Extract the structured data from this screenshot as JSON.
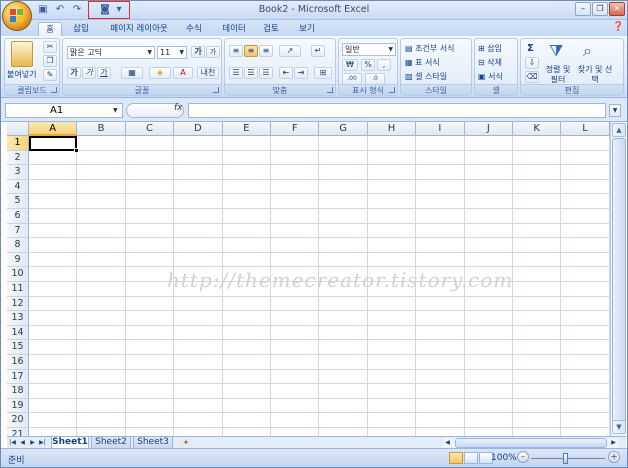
{
  "window": {
    "title": "Book2 - Microsoft Excel",
    "minimize": "–",
    "restore": "❐",
    "close": "✕"
  },
  "qat": {
    "save_icon": "save-icon",
    "undo_icon": "undo-icon",
    "redo_icon": "redo-icon",
    "camera_icon": "camera-icon",
    "customize_icon": "dropdown-icon"
  },
  "tabs": [
    "홈",
    "삽입",
    "페이지 레이아웃",
    "수식",
    "데이터",
    "검토",
    "보기"
  ],
  "active_tab": "홈",
  "ribbon": {
    "clipboard": {
      "label": "클립보드",
      "paste": "붙여넣기"
    },
    "font": {
      "label": "글꼴",
      "family": "맑은 고딕",
      "size": "11",
      "bold": "가",
      "italic": "가",
      "underline": "가",
      "grow": "가",
      "shrink": "가",
      "phonetic": "내천"
    },
    "alignment": {
      "label": "맞춤"
    },
    "number": {
      "label": "표시 형식",
      "format": "일반",
      "currency": "₩",
      "percent": "%",
      "comma": ",",
      "inc_decimal": ".00",
      "dec_decimal": ".0"
    },
    "styles": {
      "label": "스타일",
      "conditional": "조건부 서식",
      "table": "표 서식",
      "cell": "셀 스타일"
    },
    "cells": {
      "label": "셀",
      "insert": "삽입",
      "delete": "삭제",
      "format": "서식"
    },
    "editing": {
      "label": "편집",
      "sum": "Σ",
      "sort": "정렬 및 필터",
      "find": "찾기 및 선택"
    }
  },
  "formula_bar": {
    "name_box": "A1",
    "fx": "fx",
    "content": ""
  },
  "columns": [
    "A",
    "B",
    "C",
    "D",
    "E",
    "F",
    "G",
    "H",
    "I",
    "J",
    "K",
    "L"
  ],
  "rows": [
    "1",
    "2",
    "3",
    "4",
    "5",
    "6",
    "7",
    "8",
    "9",
    "10",
    "11",
    "12",
    "13",
    "14",
    "15",
    "16",
    "17",
    "18",
    "19",
    "20",
    "21"
  ],
  "active_cell": "A1",
  "watermark": "http://themecreator.tistory.com",
  "sheets": [
    "Sheet1",
    "Sheet2",
    "Sheet3"
  ],
  "active_sheet": "Sheet1",
  "status": {
    "ready": "준비",
    "zoom": "100%"
  },
  "colors": {
    "accent": "#15428b",
    "ribbon_bg": "#dde9f8",
    "highlight": "#e32b2b"
  }
}
